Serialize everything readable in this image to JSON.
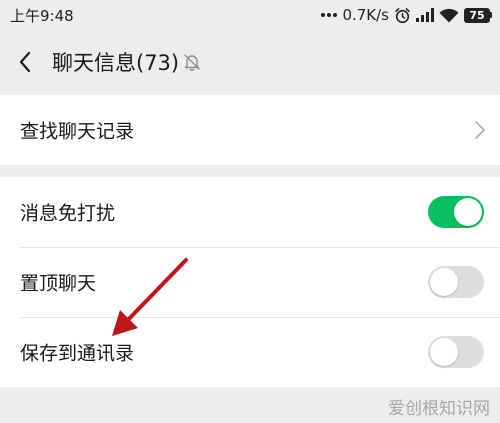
{
  "status_bar": {
    "time": "上午9:48",
    "network_speed": "0.7K/s",
    "battery_level": "75",
    "icons": [
      "signal-dots-icon",
      "alarm-icon",
      "signal-bars-icon",
      "wifi-icon",
      "battery-icon"
    ]
  },
  "nav": {
    "back_icon": "back-chevron-icon",
    "title": "聊天信息(73)",
    "mute_icon": "bell-muted-icon"
  },
  "section1": {
    "items": [
      {
        "label": "查找聊天记录",
        "control": "chevron-right-icon"
      }
    ]
  },
  "section2": {
    "items": [
      {
        "label": "消息免打扰",
        "control": "toggle",
        "checked": true
      },
      {
        "label": "置顶聊天",
        "control": "toggle",
        "checked": false
      },
      {
        "label": "保存到通讯录",
        "control": "toggle",
        "checked": false
      }
    ]
  },
  "colors": {
    "toggle_on": "#07c160",
    "toggle_off": "#dddddd",
    "background": "#ededed",
    "annotation_arrow": "#c0161b"
  },
  "watermark": {
    "text": "爱创根知识网"
  }
}
